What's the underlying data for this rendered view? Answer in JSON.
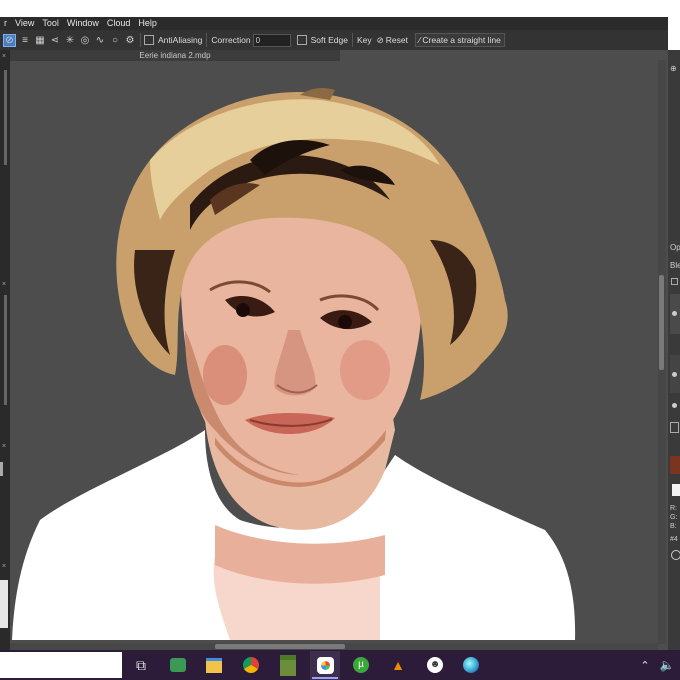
{
  "menu": [
    "r",
    "View",
    "Tool",
    "Window",
    "Cloud",
    "Help"
  ],
  "toolbar": {
    "antialiasing_label": "AntiAliasing",
    "correction_label": "Correction",
    "correction_value": "0",
    "soft_edge_label": "Soft Edge",
    "key_label": "Key",
    "reset_label": "Reset",
    "straight_line_label": "Create a straight line"
  },
  "document": {
    "tab_title": "Eerie indiana 2.mdp"
  },
  "right_panel_text": [
    "Op",
    "Ble",
    "R:",
    "G:",
    "B:",
    "#4"
  ],
  "colors": {
    "accent": "#4a7ebd",
    "canvas_bg": "#4d4d4d",
    "taskbar": "#2c1c3a",
    "swatch": "#7a3520"
  }
}
